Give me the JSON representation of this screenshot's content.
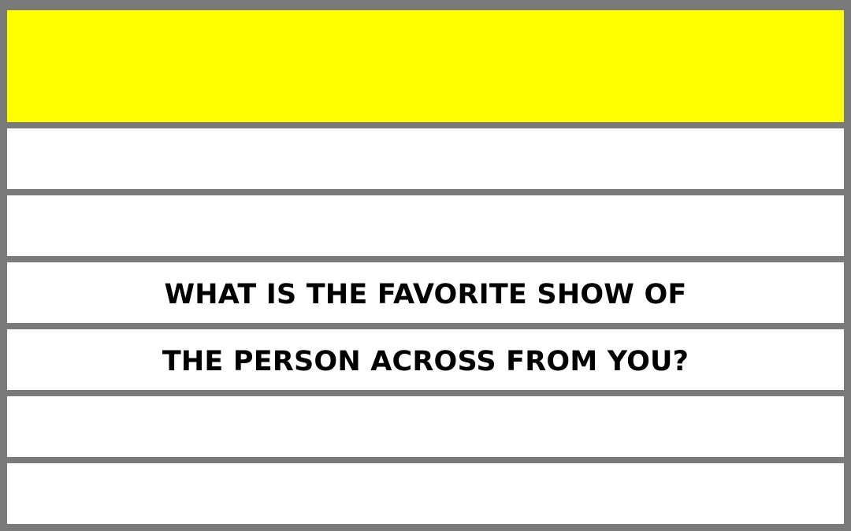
{
  "colors": {
    "header_fill": "#ffff00",
    "row_fill": "#ffffff",
    "border": "#7a7a7a",
    "text": "#000000"
  },
  "rows": [
    {
      "text": ""
    },
    {
      "text": ""
    },
    {
      "text": "WHAT IS THE FAVORITE SHOW OF"
    },
    {
      "text": "THE PERSON ACROSS FROM YOU?"
    },
    {
      "text": ""
    },
    {
      "text": ""
    }
  ]
}
